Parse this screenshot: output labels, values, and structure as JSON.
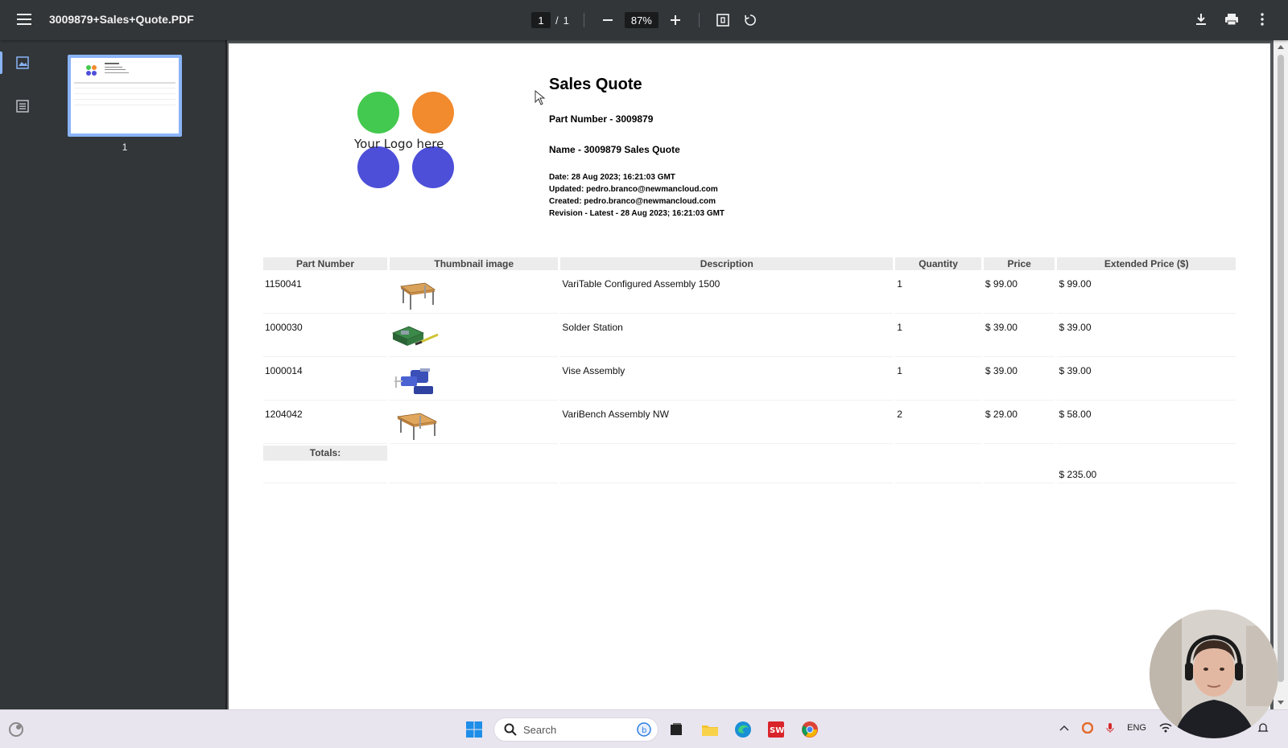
{
  "toolbar": {
    "title": "3009879+Sales+Quote.PDF",
    "current_page": "1",
    "page_separator": "/",
    "total_pages": "1",
    "zoom": "87%"
  },
  "sidebar": {
    "thumbnail_label": "1"
  },
  "document": {
    "logo_text": "Your Logo here",
    "logo_colors": [
      "#43c94f",
      "#f28a2e",
      "#4d4fd9",
      "#4d4fd9"
    ],
    "title": "Sales Quote",
    "part_number": "Part Number - 3009879",
    "name": "Name - 3009879 Sales Quote",
    "date": "Date: 28 Aug 2023; 16:21:03 GMT",
    "updated": "Updated: pedro.branco@newmancloud.com",
    "created": "Created: pedro.branco@newmancloud.com",
    "revision": "Revision - Latest - 28 Aug 2023; 16:21:03 GMT",
    "table": {
      "headers": [
        "Part Number",
        "Thumbnail image",
        "Description",
        "Quantity",
        "Price",
        "Extended Price ($)"
      ],
      "rows": [
        {
          "part": "1150041",
          "thumb": "table-icon",
          "description": "VariTable Configured Assembly 1500",
          "qty": "1",
          "price": "$ 99.00",
          "ext": "$ 99.00"
        },
        {
          "part": "1000030",
          "thumb": "solder-station-icon",
          "description": "Solder Station",
          "qty": "1",
          "price": "$ 39.00",
          "ext": "$ 39.00"
        },
        {
          "part": "1000014",
          "thumb": "vise-icon",
          "description": "Vise Assembly",
          "qty": "1",
          "price": "$ 39.00",
          "ext": "$ 39.00"
        },
        {
          "part": "1204042",
          "thumb": "bench-icon",
          "description": "VariBench Assembly NW",
          "qty": "2",
          "price": "$ 29.00",
          "ext": "$ 58.00"
        }
      ],
      "totals_label": "Totals:",
      "total": "$ 235.00"
    }
  },
  "taskbar": {
    "search_placeholder": "Search",
    "lang": "ENG"
  }
}
